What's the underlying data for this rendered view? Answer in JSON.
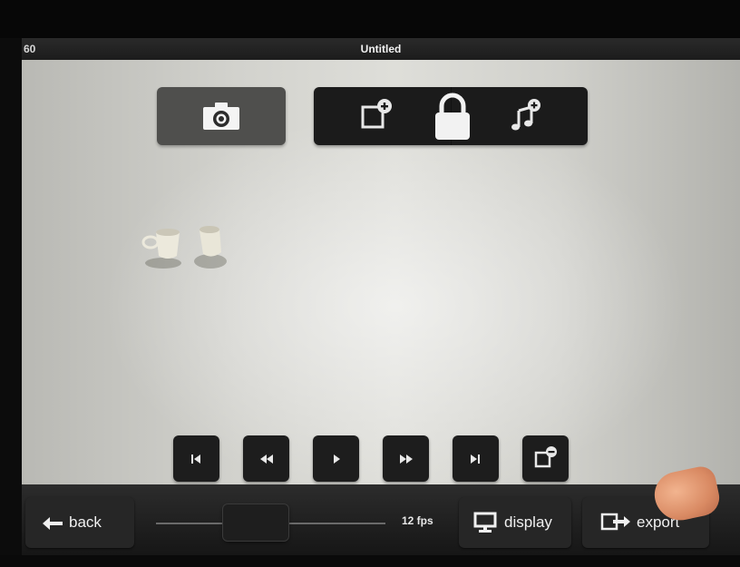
{
  "status": {
    "left_text": "60",
    "title": "Untitled"
  },
  "toolbar": {
    "camera_icon": "camera-icon",
    "add_frame_icon": "add-frame-icon",
    "lock_icon": "lock-icon",
    "add_audio_icon": "add-audio-icon"
  },
  "transport": [
    {
      "name": "jump-to-start-button",
      "icon": "skip-start-icon"
    },
    {
      "name": "rewind-button",
      "icon": "rewind-icon"
    },
    {
      "name": "play-button",
      "icon": "play-icon"
    },
    {
      "name": "fast-forward-button",
      "icon": "fast-forward-icon"
    },
    {
      "name": "jump-to-end-button",
      "icon": "skip-end-icon"
    },
    {
      "name": "delete-frame-button",
      "icon": "delete-frame-icon"
    }
  ],
  "bottom": {
    "back_label": "back",
    "fps_label": "12 fps",
    "display_label": "display",
    "export_label": "export"
  },
  "colors": {
    "stage": "#d6d6d1",
    "button_dark": "#1d1d1d",
    "camera_button": "#4f4f4d",
    "bar": "#222222"
  }
}
